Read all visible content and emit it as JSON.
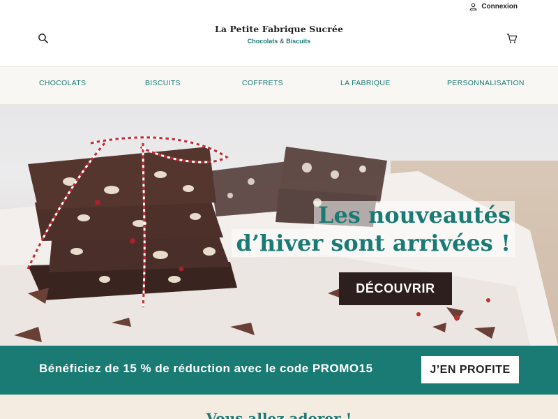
{
  "header": {
    "login_label": "Connexion",
    "brand_name": "La Petite Fabrique Sucrée",
    "tagline_part1": "Chocolats",
    "tagline_amp": "&",
    "tagline_part2": "Biscuits"
  },
  "nav": {
    "items": [
      {
        "label": "CHOCOLATS"
      },
      {
        "label": "BISCUITS"
      },
      {
        "label": "COFFRETS"
      },
      {
        "label": "LA FABRIQUE"
      },
      {
        "label": "PERSONNALISATION"
      }
    ]
  },
  "hero": {
    "title_line1": "Les nouveautés",
    "title_line2": "d’hiver sont arrivées !",
    "cta_label": "DÉCOUVRIR"
  },
  "promo": {
    "text": "Bénéficiez de 15 % de réduction avec le code PROMO15",
    "button_label": "J’EN PROFITE"
  },
  "section": {
    "title": "Vous allez adorer !"
  },
  "colors": {
    "accent": "#1a7a74",
    "dark": "#2d1f1d",
    "nav_bg": "#f8f7f4",
    "section_bg": "#f4ece0"
  },
  "icons": {
    "search": "search-icon",
    "cart": "cart-icon",
    "user": "user-icon"
  }
}
